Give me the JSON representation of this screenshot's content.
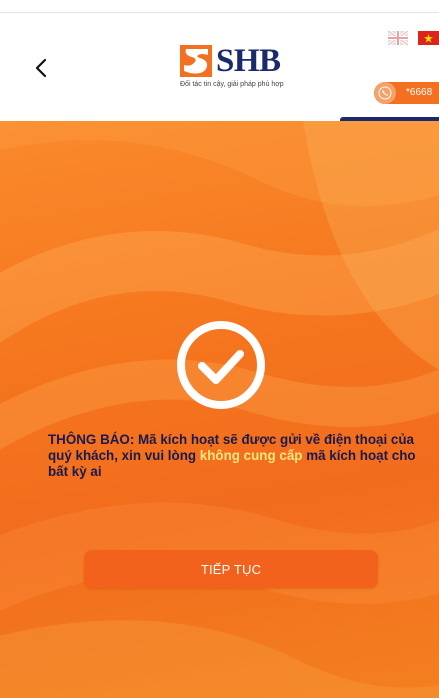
{
  "header": {
    "back_icon": "chevron-left-icon",
    "logo_text": "SHB",
    "logo_tagline": "Đối tác tin cậy, giải pháp phù hợp",
    "hotline_icon": "phone-icon",
    "hotline_number": "*6668",
    "languages": [
      "en-flag-icon",
      "vn-flag-icon"
    ]
  },
  "notice": {
    "part1": "THÔNG BÁO: Mã kích hoạt sẽ được gửi về điện thoại của quý khách, xin vui lòng ",
    "highlight": "không cung cấp",
    "part2": " mã kích hoạt cho bất kỳ ai"
  },
  "actions": {
    "continue_label": "TIẾP TỤC"
  },
  "colors": {
    "brand_orange": "#f37021",
    "brand_navy": "#1a2a6c",
    "highlight_yellow": "#ffe680"
  },
  "status_icon": "check-circle-icon"
}
